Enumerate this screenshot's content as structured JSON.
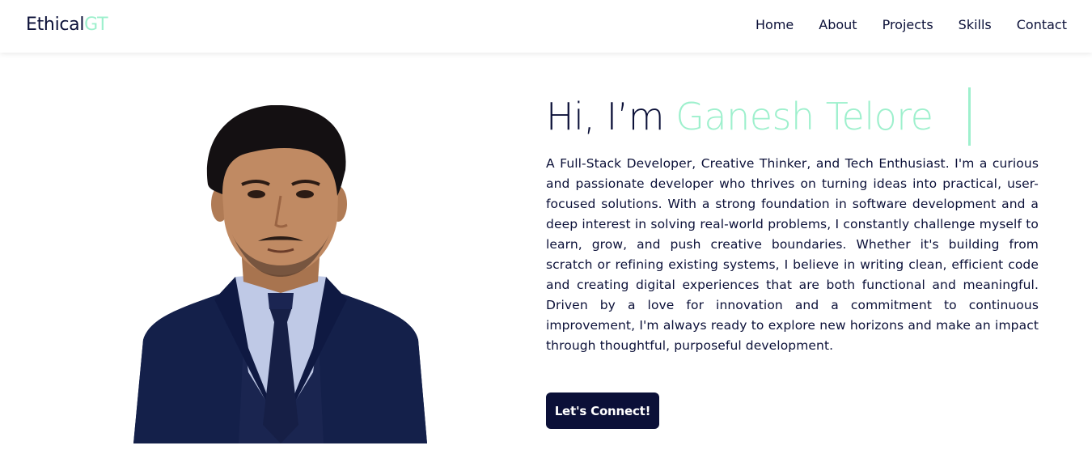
{
  "brand": {
    "logo_primary": "Ethical",
    "logo_accent": "GT",
    "accent_color": "#9ef0cd",
    "primary_color": "#0b1038"
  },
  "nav": {
    "items": [
      {
        "label": "Home"
      },
      {
        "label": "About"
      },
      {
        "label": "Projects"
      },
      {
        "label": "Skills"
      },
      {
        "label": "Contact"
      }
    ]
  },
  "hero": {
    "greeting": "Hi, I’m ",
    "name": "Ganesh Telore",
    "intro": "A Full-Stack Developer, Creative Thinker, and Tech Enthusiast. I'm a curious and passionate developer who thrives on turning ideas into practical, user-focused solutions. With a strong foundation in software development and a deep interest in solving real-world problems, I constantly challenge myself to learn, grow, and push creative boundaries. Whether it's building from scratch or refining existing systems, I believe in writing clean, efficient code and creating digital experiences that are both functional and meaningful. Driven by a love for innovation and a commitment to continuous improvement, I'm always ready to explore new horizons and make an impact through thoughtful, purposeful development.",
    "cta_label": "Let's Connect!"
  }
}
